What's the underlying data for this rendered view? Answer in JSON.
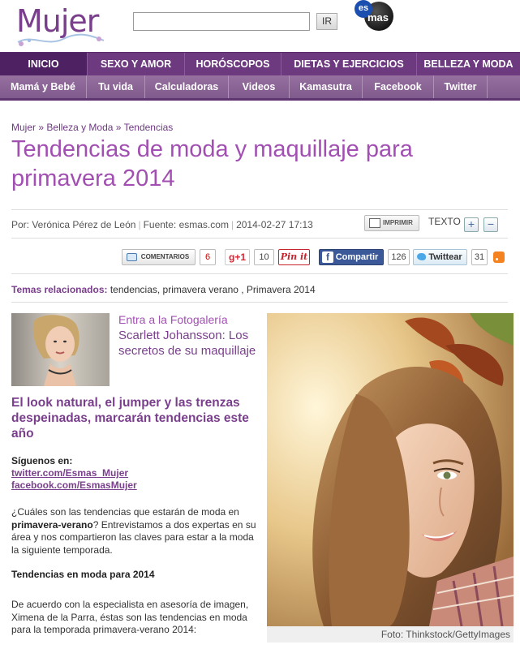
{
  "header": {
    "logo_text": "Mujer",
    "search_value": "",
    "search_button": "IR",
    "esmas_es": "es",
    "esmas_mas": "mas"
  },
  "nav_primary": [
    "INICIO",
    "SEXO Y AMOR",
    "HORÓSCOPOS",
    "DIETAS Y EJERCICIOS",
    "BELLEZA Y MODA"
  ],
  "nav_secondary": [
    "Mamá y Bebé",
    "Tu vida",
    "Calculadoras",
    "Videos",
    "Kamasutra",
    "Facebook",
    "Twitter"
  ],
  "breadcrumb": {
    "items": [
      "Mujer",
      "Belleza y Moda",
      "Tendencias"
    ],
    "separator": "»"
  },
  "article": {
    "title": "Tendencias de moda y maquillaje para primavera 2014",
    "author": "Por: Verónica Pérez de León",
    "source": "Fuente: esmas.com",
    "datetime": "2014-02-27 17:13"
  },
  "tools": {
    "print_label": "IMPRIMIR",
    "text_label": "TEXTO",
    "increase": "+",
    "decrease": "−"
  },
  "social": {
    "comments_label": "COMENTARIOS",
    "comments_count": "6",
    "gplus_label": "g+1",
    "gplus_count": "10",
    "pinit_label": "Pin it",
    "facebook_label": "Compartir",
    "facebook_count": "126",
    "twitter_label": "Twittear",
    "twitter_count": "31"
  },
  "related": {
    "label": "Temas relacionados:",
    "tags": "tendencias, primavera verano , Primavera 2014"
  },
  "gallery": {
    "intro": "Entra a la Fotogalería",
    "title": "Scarlett Johansson: Los secretos de su maquillaje"
  },
  "body": {
    "subhead": "El look natural, el jumper y las trenzas despeinadas, marcarán tendencias este año",
    "follow_label": "Síguenos en:",
    "twitter_link": "twitter.com/Esmas_Mujer",
    "facebook_link": "facebook.com/EsmasMujer",
    "para1_a": "¿Cuáles son las tendencias que estarán de moda en ",
    "para1_b": "primavera-verano",
    "para1_c": "? Entrevistamos a dos expertas en su área y nos compartieron las claves para estar a la moda la siguiente temporada.",
    "section_heading": "Tendencias en moda para 2014",
    "para2": "De acuerdo con la especialista en asesoría de imagen, Ximena de la Parra, éstas son las tendencias en moda para la temporada primavera-verano 2014:"
  },
  "photo": {
    "caption": "Foto: Thinkstock/GettyImages"
  },
  "colors": {
    "brand_purple": "#6d3a80",
    "title_purple": "#a24fb2",
    "facebook_blue": "#3b5998"
  }
}
